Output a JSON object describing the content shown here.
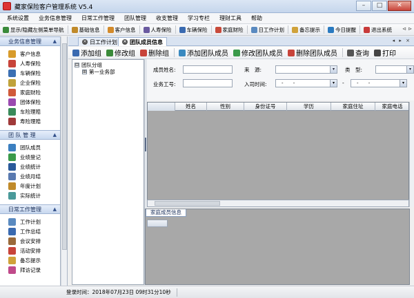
{
  "window": {
    "title": "藏家保险客户管理系统 V5.4",
    "minimize": "–",
    "maximize": "□",
    "close": "✕"
  },
  "menu": [
    "系统设置",
    "业务信息管理",
    "日常工作管理",
    "团队管理",
    "收支管理",
    "学习专栏",
    "理财工具",
    "帮助"
  ],
  "toolbar": {
    "items": [
      {
        "label": "显示/隐藏左侧菜单导航",
        "icon": "arrow-left-icon",
        "color": "#3a8a3a"
      },
      {
        "label": "基础信息",
        "icon": "book-icon",
        "color": "#c08a2a"
      },
      {
        "label": "客户信息",
        "icon": "person-icon",
        "color": "#d38a2a"
      },
      {
        "label": "人寿保险",
        "icon": "life-icon",
        "color": "#6a5aa0"
      },
      {
        "label": "车辆保险",
        "icon": "car-icon",
        "color": "#3a6ab0"
      },
      {
        "label": "家庭财险",
        "icon": "house-icon",
        "color": "#c84a3a"
      },
      {
        "label": "日工作计划",
        "icon": "calendar-icon",
        "color": "#5a8ac0"
      },
      {
        "label": "备忘提示",
        "icon": "memo-icon",
        "color": "#d0a23a"
      },
      {
        "label": "今日提醒",
        "icon": "reminder-icon",
        "color": "#2a7ac0"
      },
      {
        "label": "退出系统",
        "icon": "exit-icon",
        "color": "#c83a3a"
      }
    ],
    "tail": "⊲ ⊳"
  },
  "nav": {
    "sections": [
      {
        "title": "业务信息管理",
        "chevron": "▲",
        "items": [
          {
            "label": "客户信息",
            "icon": "customer-icon",
            "color": "#d89b2b"
          },
          {
            "label": "人寿保险",
            "icon": "life-insurance-icon",
            "color": "#c8443a"
          },
          {
            "label": "车辆保险",
            "icon": "car-insurance-icon",
            "color": "#3b6fb3"
          },
          {
            "label": "企业保险",
            "icon": "enterprise-insurance-icon",
            "color": "#c0a23a"
          },
          {
            "label": "家庭财险",
            "icon": "home-insurance-icon",
            "color": "#d05a3a"
          },
          {
            "label": "团体保险",
            "icon": "group-insurance-icon",
            "color": "#9a4ab0"
          },
          {
            "label": "车险理赔",
            "icon": "car-claim-icon",
            "color": "#3a8a5a"
          },
          {
            "label": "寿险理赔",
            "icon": "life-claim-icon",
            "color": "#a03a3a"
          }
        ]
      },
      {
        "title": "团 队 管 理",
        "chevron": "▲",
        "items": [
          {
            "label": "团队成员",
            "icon": "team-member-icon",
            "color": "#3b7fc0"
          },
          {
            "label": "业绩登记",
            "icon": "performance-register-icon",
            "color": "#3a9a4a"
          },
          {
            "label": "业绩统计",
            "icon": "performance-stats-icon",
            "color": "#2a5a9a"
          },
          {
            "label": "业绩月结",
            "icon": "monthly-close-icon",
            "color": "#5a7ab0"
          },
          {
            "label": "年度计划",
            "icon": "annual-plan-icon",
            "color": "#c08a2a"
          },
          {
            "label": "实际统计",
            "icon": "actual-stats-icon",
            "color": "#4a9a9a"
          }
        ]
      },
      {
        "title": "日常工作管理",
        "chevron": "▲",
        "items": [
          {
            "label": "工作计划",
            "icon": "work-plan-icon",
            "color": "#5a8ac0"
          },
          {
            "label": "工作总结",
            "icon": "work-summary-icon",
            "color": "#3a6ab0"
          },
          {
            "label": "会议安排",
            "icon": "meeting-icon",
            "color": "#9a6a3a"
          },
          {
            "label": "活动安排",
            "icon": "activity-icon",
            "color": "#c8443a"
          },
          {
            "label": "备忘提示",
            "icon": "memo-reminder-icon",
            "color": "#d0a23a"
          },
          {
            "label": "拜访记录",
            "icon": "visit-record-icon",
            "color": "#c04a8a"
          }
        ]
      }
    ]
  },
  "tabs": [
    {
      "label": "日工作计划",
      "active": false
    },
    {
      "label": "团队成员信息",
      "active": true
    }
  ],
  "tab_nav": "◂ ▸ ×",
  "content_toolbar": [
    {
      "label": "添加组",
      "icon": "add-group-icon",
      "color": "#3a6ab0"
    },
    {
      "label": "修改组",
      "icon": "edit-group-icon",
      "color": "#3a8a3a"
    },
    {
      "label": "删除组",
      "icon": "delete-group-icon",
      "color": "#c8443a"
    },
    {
      "label": "添加团队成员",
      "icon": "add-member-icon",
      "color": "#3a8ac0"
    },
    {
      "label": "修改团队成员",
      "icon": "edit-member-icon",
      "color": "#3a9a4a"
    },
    {
      "label": "删除团队成员",
      "icon": "delete-member-icon",
      "color": "#c8443a"
    },
    {
      "label": "查询",
      "icon": "search-icon",
      "color": "#555555"
    },
    {
      "label": "打印",
      "icon": "print-icon",
      "color": "#444444"
    }
  ],
  "tree": {
    "root": {
      "label": "团队分组",
      "toggle": "⊟"
    },
    "children": [
      {
        "label": "第一业务部",
        "toggle": "⊞"
      }
    ]
  },
  "form": {
    "name_label": "成员姓名:",
    "source_label": "来　源:",
    "type_label": "类　型:",
    "work_id_label": "业务工号:",
    "join_time_label": "入司时间:",
    "date_from": "- -",
    "date_to": "- -",
    "date_sep": "-",
    "dropdown_arrow": "▾"
  },
  "grid": {
    "columns": [
      "姓名",
      "性别",
      "身份证号",
      "学历",
      "家庭住址",
      "家庭电话"
    ]
  },
  "family_panel": {
    "title": "家庭成员信息"
  },
  "status": {
    "login_time": "登录时间：2018年07月23日 09时31分10秒"
  },
  "scroll": {
    "up": "▴",
    "down": "▾",
    "left": "◂",
    "right": "▸"
  }
}
